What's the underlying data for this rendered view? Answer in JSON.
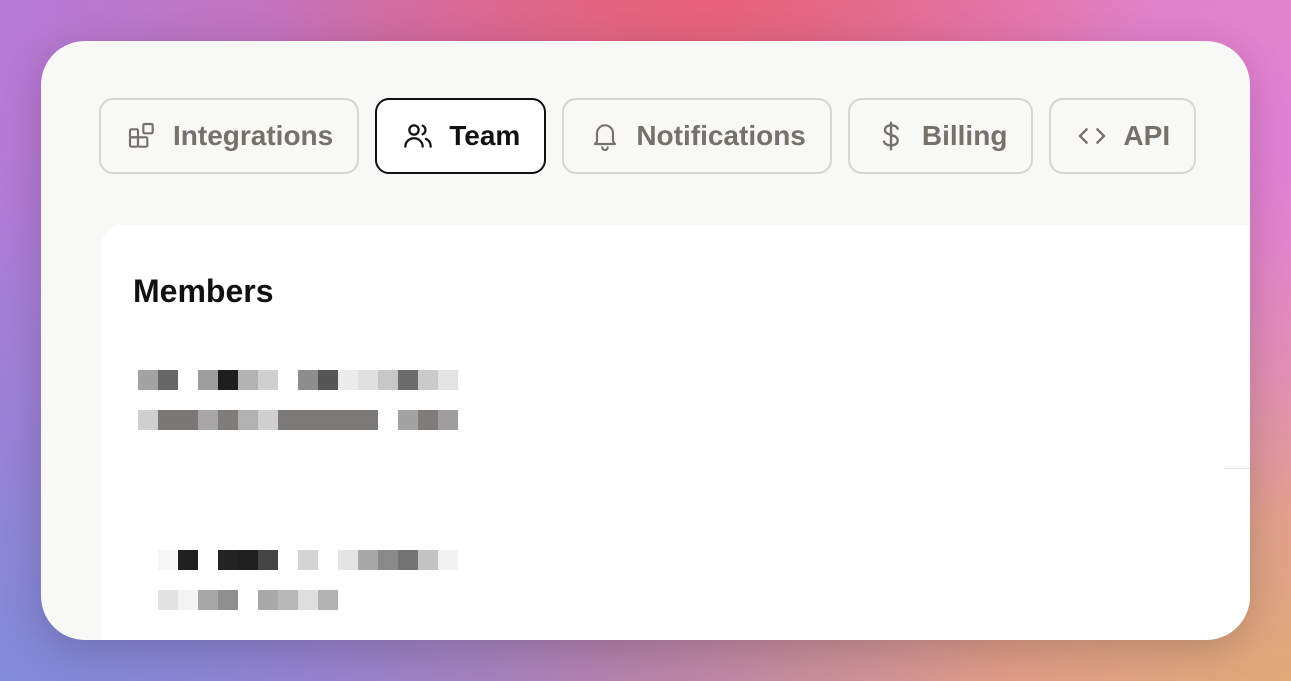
{
  "tabs": [
    {
      "label": "Integrations",
      "icon": "integrations-icon",
      "active": false
    },
    {
      "label": "Team",
      "icon": "team-icon",
      "active": true
    },
    {
      "label": "Notifications",
      "icon": "bell-icon",
      "active": false
    },
    {
      "label": "Billing",
      "icon": "dollar-icon",
      "active": false
    },
    {
      "label": "API",
      "icon": "code-icon",
      "active": false
    }
  ],
  "panel": {
    "title": "Members"
  },
  "colors": {
    "active_border": "#111111",
    "inactive_text": "#76716b",
    "inactive_border": "#d6d5d2"
  }
}
